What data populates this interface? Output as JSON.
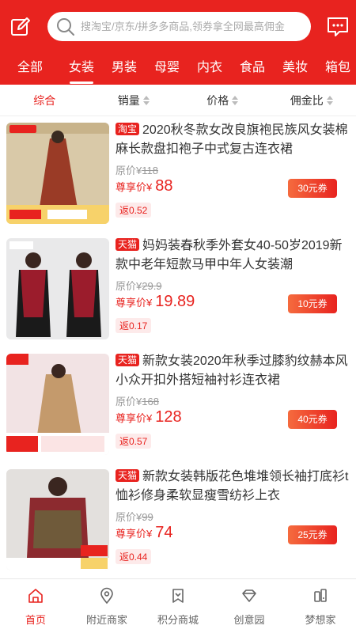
{
  "header": {
    "search_placeholder": "搜淘宝/京东/拼多多商品,领券拿全网最高佣金"
  },
  "categories": [
    {
      "label": "全部",
      "active": false
    },
    {
      "label": "女装",
      "active": true
    },
    {
      "label": "男装",
      "active": false
    },
    {
      "label": "母婴",
      "active": false
    },
    {
      "label": "内衣",
      "active": false
    },
    {
      "label": "食品",
      "active": false
    },
    {
      "label": "美妆",
      "active": false
    },
    {
      "label": "箱包",
      "active": false
    }
  ],
  "sort": [
    {
      "label": "综合",
      "active": true
    },
    {
      "label": "销量",
      "active": false
    },
    {
      "label": "价格",
      "active": false
    },
    {
      "label": "佣金比",
      "active": false
    }
  ],
  "products": [
    {
      "badge": "淘宝",
      "title": "2020秋冬款女改良旗袍民族风女装棉麻长款盘扣袍子中式复古连衣裙",
      "orig_label": "原价¥",
      "orig_price": "118",
      "vip_label": "尊享价¥",
      "price": "88",
      "coupon": "30元券",
      "rebate": "返0.52"
    },
    {
      "badge": "天猫",
      "title": "妈妈装春秋季外套女40-50岁2019新款中老年短款马甲中年人女装潮",
      "orig_label": "原价¥",
      "orig_price": "29.9",
      "vip_label": "尊享价¥",
      "price": "19.89",
      "coupon": "10元券",
      "rebate": "返0.17"
    },
    {
      "badge": "天猫",
      "title": "新款女装2020年秋季过膝豹纹赫本风小众开扣外搭短袖衬衫连衣裙",
      "orig_label": "原价¥",
      "orig_price": "168",
      "vip_label": "尊享价¥",
      "price": "128",
      "coupon": "40元券",
      "rebate": "返0.57"
    },
    {
      "badge": "天猫",
      "title": "新款女装韩版花色堆堆领长袖打底衫t恤衫修身柔软显瘦雪纺衫上衣",
      "orig_label": "原价¥",
      "orig_price": "99",
      "vip_label": "尊享价¥",
      "price": "74",
      "coupon": "25元券",
      "rebate": "返0.44"
    }
  ],
  "tabs": [
    {
      "label": "首页",
      "icon": "home-icon",
      "active": true
    },
    {
      "label": "附近商家",
      "icon": "location-icon",
      "active": false
    },
    {
      "label": "积分商城",
      "icon": "bookmark-icon",
      "active": false
    },
    {
      "label": "创意园",
      "icon": "diamond-icon",
      "active": false
    },
    {
      "label": "梦想家",
      "icon": "phone-icon",
      "active": false
    }
  ],
  "colors": {
    "brand": "#e8231f",
    "coupon_start": "#f56b3e"
  }
}
